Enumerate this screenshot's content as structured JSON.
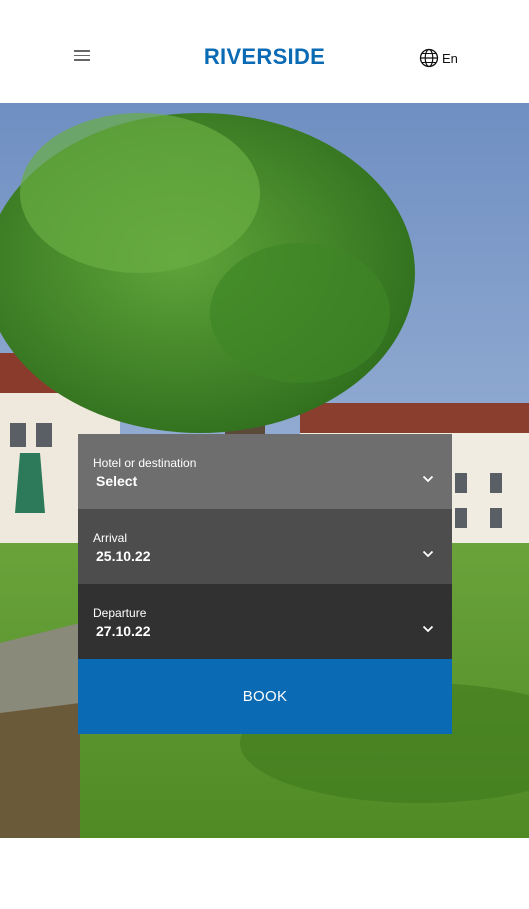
{
  "header": {
    "brand": "RIVERSIDE",
    "language": "En",
    "menu_icon": "hamburger-menu-icon",
    "language_icon": "globe-icon"
  },
  "booking": {
    "hotel": {
      "label": "Hotel or destination",
      "value": "Select"
    },
    "arrival": {
      "label": "Arrival",
      "value": "25.10.22"
    },
    "departure": {
      "label": "Departure",
      "value": "27.10.22"
    },
    "chevron_icon": "chevron-down-icon",
    "book_label": "BOOK"
  },
  "colors": {
    "brand": "#0a6ab4",
    "field_1": "#6e6e6e",
    "field_2": "#4d4d4d",
    "field_3": "#313131"
  }
}
